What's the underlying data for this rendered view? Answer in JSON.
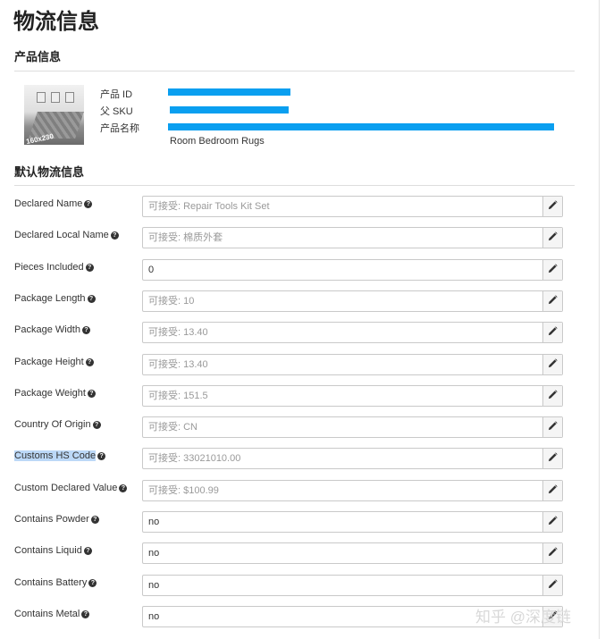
{
  "page": {
    "title": "物流信息"
  },
  "product_section": {
    "title": "产品信息",
    "image_text": "160x230",
    "labels": {
      "product_id": "产品 ID",
      "parent_sku": "父 SKU",
      "product_name": "产品名称"
    },
    "product_name_value": "Room Bedroom Rugs",
    "redaction_color": "#0a9ff0"
  },
  "logistics_section": {
    "title": "默认物流信息",
    "rows": [
      {
        "label": "Declared Name",
        "placeholder": "可接受: Repair Tools Kit Set",
        "value": ""
      },
      {
        "label": "Declared Local Name",
        "placeholder": "可接受: 棉质外套",
        "value": ""
      },
      {
        "label": "Pieces Included",
        "placeholder": "",
        "value": "0"
      },
      {
        "label": "Package Length",
        "placeholder": "可接受: 10",
        "value": ""
      },
      {
        "label": "Package Width",
        "placeholder": "可接受: 13.40",
        "value": ""
      },
      {
        "label": "Package Height",
        "placeholder": "可接受: 13.40",
        "value": ""
      },
      {
        "label": "Package Weight",
        "placeholder": "可接受: 151.5",
        "value": ""
      },
      {
        "label": "Country Of Origin",
        "placeholder": "可接受: CN",
        "value": ""
      },
      {
        "label": "Customs HS Code",
        "placeholder": "可接受: 33021010.00",
        "value": "",
        "selected": true
      },
      {
        "label": "Custom Declared Value",
        "placeholder": "可接受: $100.99",
        "value": ""
      },
      {
        "label": "Contains Powder",
        "placeholder": "",
        "value": "no"
      },
      {
        "label": "Contains Liquid",
        "placeholder": "",
        "value": "no"
      },
      {
        "label": "Contains Battery",
        "placeholder": "",
        "value": "no"
      },
      {
        "label": "Contains Metal",
        "placeholder": "",
        "value": "no"
      }
    ]
  },
  "icons": {
    "help": "question-circle-icon",
    "edit": "pencil-icon"
  },
  "watermark": "知乎 @深度链",
  "colors": {
    "selection_highlight": "#bcd8f7"
  }
}
